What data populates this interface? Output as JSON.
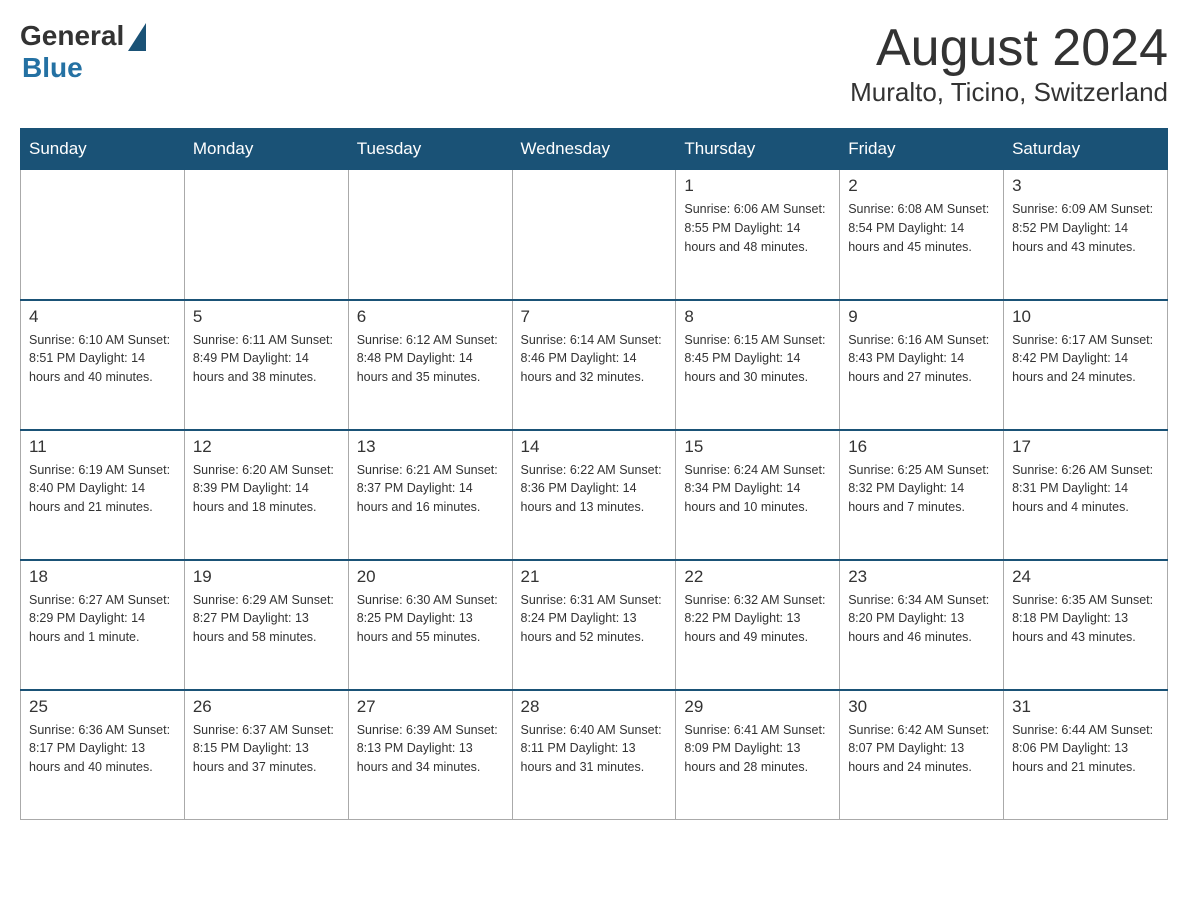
{
  "header": {
    "logo_general": "General",
    "logo_blue": "Blue",
    "month_title": "August 2024",
    "location": "Muralto, Ticino, Switzerland"
  },
  "days_of_week": [
    "Sunday",
    "Monday",
    "Tuesday",
    "Wednesday",
    "Thursday",
    "Friday",
    "Saturday"
  ],
  "weeks": [
    [
      {
        "day": "",
        "info": ""
      },
      {
        "day": "",
        "info": ""
      },
      {
        "day": "",
        "info": ""
      },
      {
        "day": "",
        "info": ""
      },
      {
        "day": "1",
        "info": "Sunrise: 6:06 AM\nSunset: 8:55 PM\nDaylight: 14 hours and 48 minutes."
      },
      {
        "day": "2",
        "info": "Sunrise: 6:08 AM\nSunset: 8:54 PM\nDaylight: 14 hours and 45 minutes."
      },
      {
        "day": "3",
        "info": "Sunrise: 6:09 AM\nSunset: 8:52 PM\nDaylight: 14 hours and 43 minutes."
      }
    ],
    [
      {
        "day": "4",
        "info": "Sunrise: 6:10 AM\nSunset: 8:51 PM\nDaylight: 14 hours and 40 minutes."
      },
      {
        "day": "5",
        "info": "Sunrise: 6:11 AM\nSunset: 8:49 PM\nDaylight: 14 hours and 38 minutes."
      },
      {
        "day": "6",
        "info": "Sunrise: 6:12 AM\nSunset: 8:48 PM\nDaylight: 14 hours and 35 minutes."
      },
      {
        "day": "7",
        "info": "Sunrise: 6:14 AM\nSunset: 8:46 PM\nDaylight: 14 hours and 32 minutes."
      },
      {
        "day": "8",
        "info": "Sunrise: 6:15 AM\nSunset: 8:45 PM\nDaylight: 14 hours and 30 minutes."
      },
      {
        "day": "9",
        "info": "Sunrise: 6:16 AM\nSunset: 8:43 PM\nDaylight: 14 hours and 27 minutes."
      },
      {
        "day": "10",
        "info": "Sunrise: 6:17 AM\nSunset: 8:42 PM\nDaylight: 14 hours and 24 minutes."
      }
    ],
    [
      {
        "day": "11",
        "info": "Sunrise: 6:19 AM\nSunset: 8:40 PM\nDaylight: 14 hours and 21 minutes."
      },
      {
        "day": "12",
        "info": "Sunrise: 6:20 AM\nSunset: 8:39 PM\nDaylight: 14 hours and 18 minutes."
      },
      {
        "day": "13",
        "info": "Sunrise: 6:21 AM\nSunset: 8:37 PM\nDaylight: 14 hours and 16 minutes."
      },
      {
        "day": "14",
        "info": "Sunrise: 6:22 AM\nSunset: 8:36 PM\nDaylight: 14 hours and 13 minutes."
      },
      {
        "day": "15",
        "info": "Sunrise: 6:24 AM\nSunset: 8:34 PM\nDaylight: 14 hours and 10 minutes."
      },
      {
        "day": "16",
        "info": "Sunrise: 6:25 AM\nSunset: 8:32 PM\nDaylight: 14 hours and 7 minutes."
      },
      {
        "day": "17",
        "info": "Sunrise: 6:26 AM\nSunset: 8:31 PM\nDaylight: 14 hours and 4 minutes."
      }
    ],
    [
      {
        "day": "18",
        "info": "Sunrise: 6:27 AM\nSunset: 8:29 PM\nDaylight: 14 hours and 1 minute."
      },
      {
        "day": "19",
        "info": "Sunrise: 6:29 AM\nSunset: 8:27 PM\nDaylight: 13 hours and 58 minutes."
      },
      {
        "day": "20",
        "info": "Sunrise: 6:30 AM\nSunset: 8:25 PM\nDaylight: 13 hours and 55 minutes."
      },
      {
        "day": "21",
        "info": "Sunrise: 6:31 AM\nSunset: 8:24 PM\nDaylight: 13 hours and 52 minutes."
      },
      {
        "day": "22",
        "info": "Sunrise: 6:32 AM\nSunset: 8:22 PM\nDaylight: 13 hours and 49 minutes."
      },
      {
        "day": "23",
        "info": "Sunrise: 6:34 AM\nSunset: 8:20 PM\nDaylight: 13 hours and 46 minutes."
      },
      {
        "day": "24",
        "info": "Sunrise: 6:35 AM\nSunset: 8:18 PM\nDaylight: 13 hours and 43 minutes."
      }
    ],
    [
      {
        "day": "25",
        "info": "Sunrise: 6:36 AM\nSunset: 8:17 PM\nDaylight: 13 hours and 40 minutes."
      },
      {
        "day": "26",
        "info": "Sunrise: 6:37 AM\nSunset: 8:15 PM\nDaylight: 13 hours and 37 minutes."
      },
      {
        "day": "27",
        "info": "Sunrise: 6:39 AM\nSunset: 8:13 PM\nDaylight: 13 hours and 34 minutes."
      },
      {
        "day": "28",
        "info": "Sunrise: 6:40 AM\nSunset: 8:11 PM\nDaylight: 13 hours and 31 minutes."
      },
      {
        "day": "29",
        "info": "Sunrise: 6:41 AM\nSunset: 8:09 PM\nDaylight: 13 hours and 28 minutes."
      },
      {
        "day": "30",
        "info": "Sunrise: 6:42 AM\nSunset: 8:07 PM\nDaylight: 13 hours and 24 minutes."
      },
      {
        "day": "31",
        "info": "Sunrise: 6:44 AM\nSunset: 8:06 PM\nDaylight: 13 hours and 21 minutes."
      }
    ]
  ]
}
